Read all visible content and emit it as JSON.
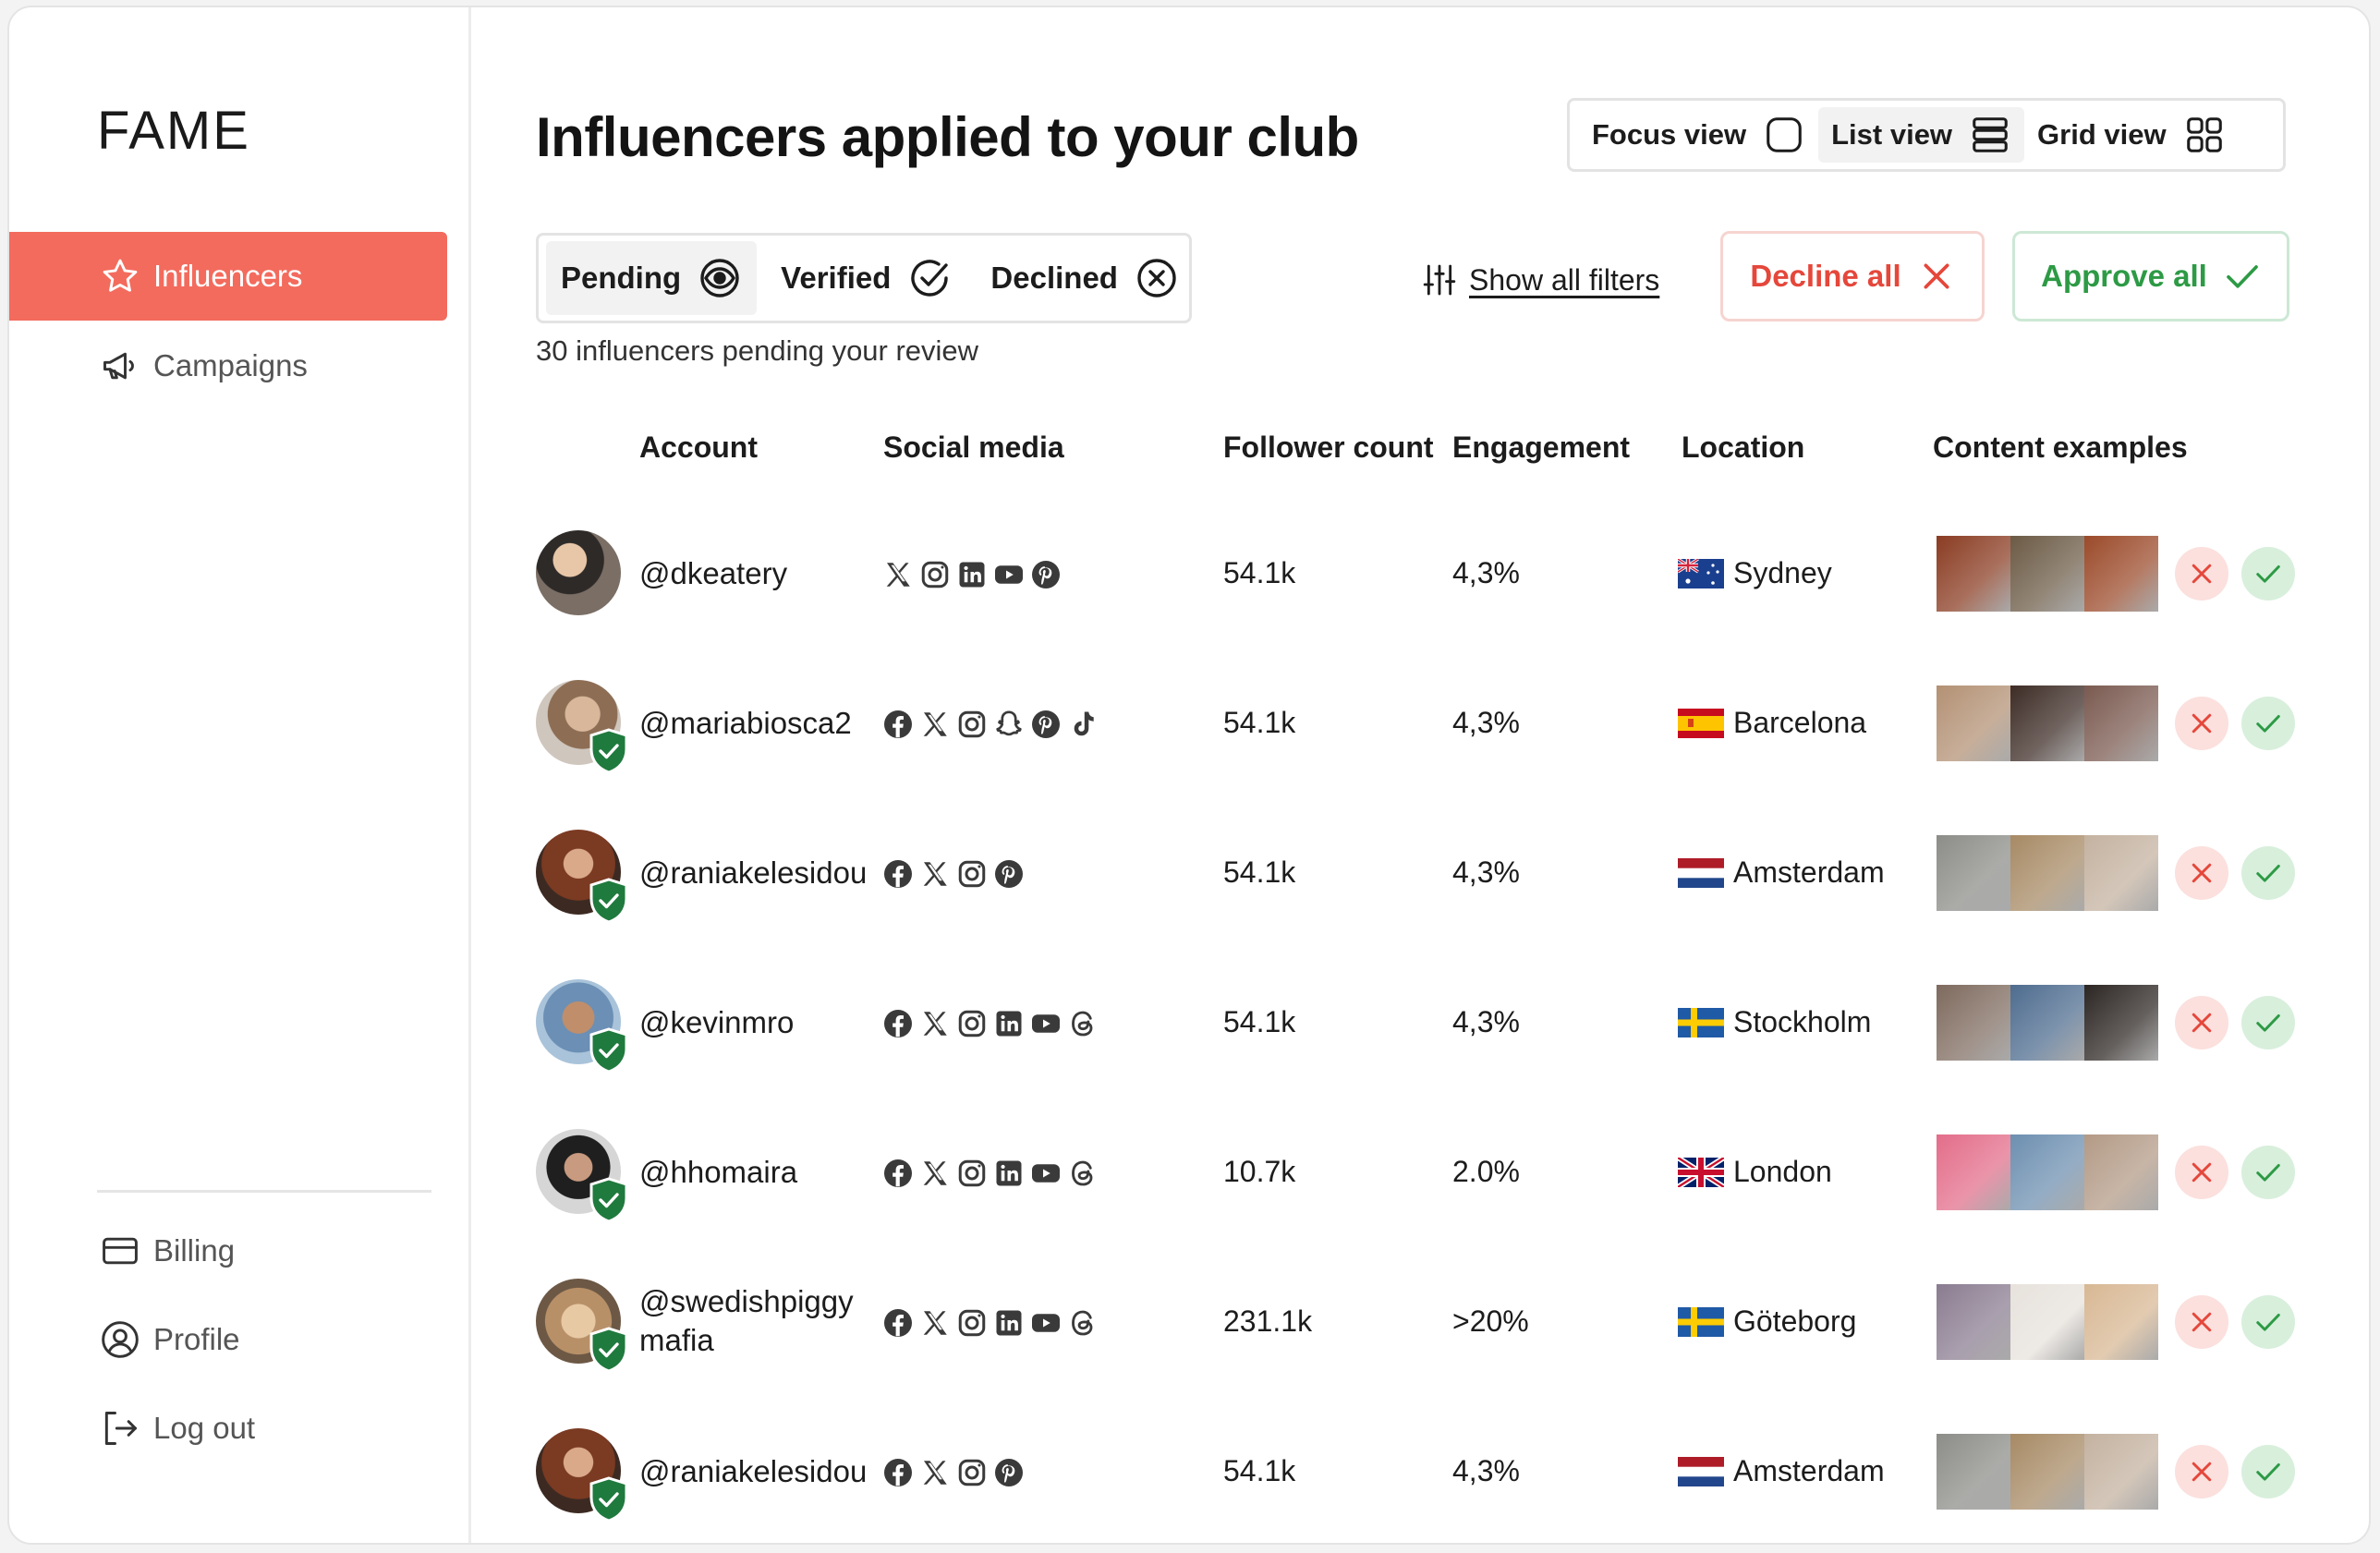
{
  "app": {
    "logo": "FAME"
  },
  "sidebar": {
    "items": [
      {
        "label": "Influencers",
        "icon": "star-icon"
      },
      {
        "label": "Campaigns",
        "icon": "megaphone-icon"
      }
    ],
    "bottom_items": [
      {
        "label": "Billing",
        "icon": "credit-card-icon"
      },
      {
        "label": "Profile",
        "icon": "user-circle-icon"
      },
      {
        "label": "Log out",
        "icon": "logout-icon"
      }
    ]
  },
  "header": {
    "title": "Influencers applied to your club",
    "views": [
      {
        "label": "Focus view",
        "icon": "focus-square-icon",
        "selected": false
      },
      {
        "label": "List view",
        "icon": "list-icon",
        "selected": true
      },
      {
        "label": "Grid view",
        "icon": "grid-icon",
        "selected": false
      }
    ]
  },
  "status_tabs": [
    {
      "label": "Pending",
      "icon": "eye-target-icon",
      "selected": true
    },
    {
      "label": "Verified",
      "icon": "check-circle-icon",
      "selected": false
    },
    {
      "label": "Declined",
      "icon": "x-circle-icon",
      "selected": false
    }
  ],
  "pending_count_text": "30 influencers pending your review",
  "actions": {
    "filters_label": "Show all filters",
    "decline_all": "Decline all",
    "approve_all": "Approve all"
  },
  "colors": {
    "accent": "#f36b5d",
    "decline": "#e5473b",
    "approve": "#2d9a45",
    "verified": "#1f7a3e"
  },
  "table": {
    "columns": [
      "Account",
      "Social media",
      "Follower count",
      "Engagement",
      "Location",
      "Content examples"
    ],
    "rows": [
      {
        "handle": "@dkeatery",
        "verified": false,
        "socials": [
          "x",
          "instagram",
          "linkedin",
          "youtube",
          "pinterest"
        ],
        "followers": "54.1k",
        "engagement": "4,3%",
        "flag": "australia",
        "location": "Sydney"
      },
      {
        "handle": "@mariabiosca2",
        "verified": true,
        "socials": [
          "facebook",
          "x",
          "instagram",
          "snapchat",
          "pinterest",
          "tiktok"
        ],
        "followers": "54.1k",
        "engagement": "4,3%",
        "flag": "spain",
        "location": "Barcelona"
      },
      {
        "handle": "@raniakelesidou",
        "verified": true,
        "socials": [
          "facebook",
          "x",
          "instagram",
          "pinterest"
        ],
        "followers": "54.1k",
        "engagement": "4,3%",
        "flag": "netherlands",
        "location": "Amsterdam"
      },
      {
        "handle": "@kevinmro",
        "verified": true,
        "socials": [
          "facebook",
          "x",
          "instagram",
          "linkedin",
          "youtube",
          "threads"
        ],
        "followers": "54.1k",
        "engagement": "4,3%",
        "flag": "sweden",
        "location": "Stockholm"
      },
      {
        "handle": "@hhomaira",
        "verified": true,
        "socials": [
          "facebook",
          "x",
          "instagram",
          "linkedin",
          "youtube",
          "threads"
        ],
        "followers": "10.7k",
        "engagement": "2.0%",
        "flag": "uk",
        "location": "London"
      },
      {
        "handle": "@swedishpiggy mafia",
        "verified": true,
        "socials": [
          "facebook",
          "x",
          "instagram",
          "linkedin",
          "youtube",
          "threads"
        ],
        "followers": "231.1k",
        "engagement": ">20%",
        "flag": "sweden",
        "location": "Göteborg"
      },
      {
        "handle": "@raniakelesidou",
        "verified": true,
        "socials": [
          "facebook",
          "x",
          "instagram",
          "pinterest"
        ],
        "followers": "54.1k",
        "engagement": "4,3%",
        "flag": "netherlands",
        "location": "Amsterdam"
      }
    ]
  }
}
